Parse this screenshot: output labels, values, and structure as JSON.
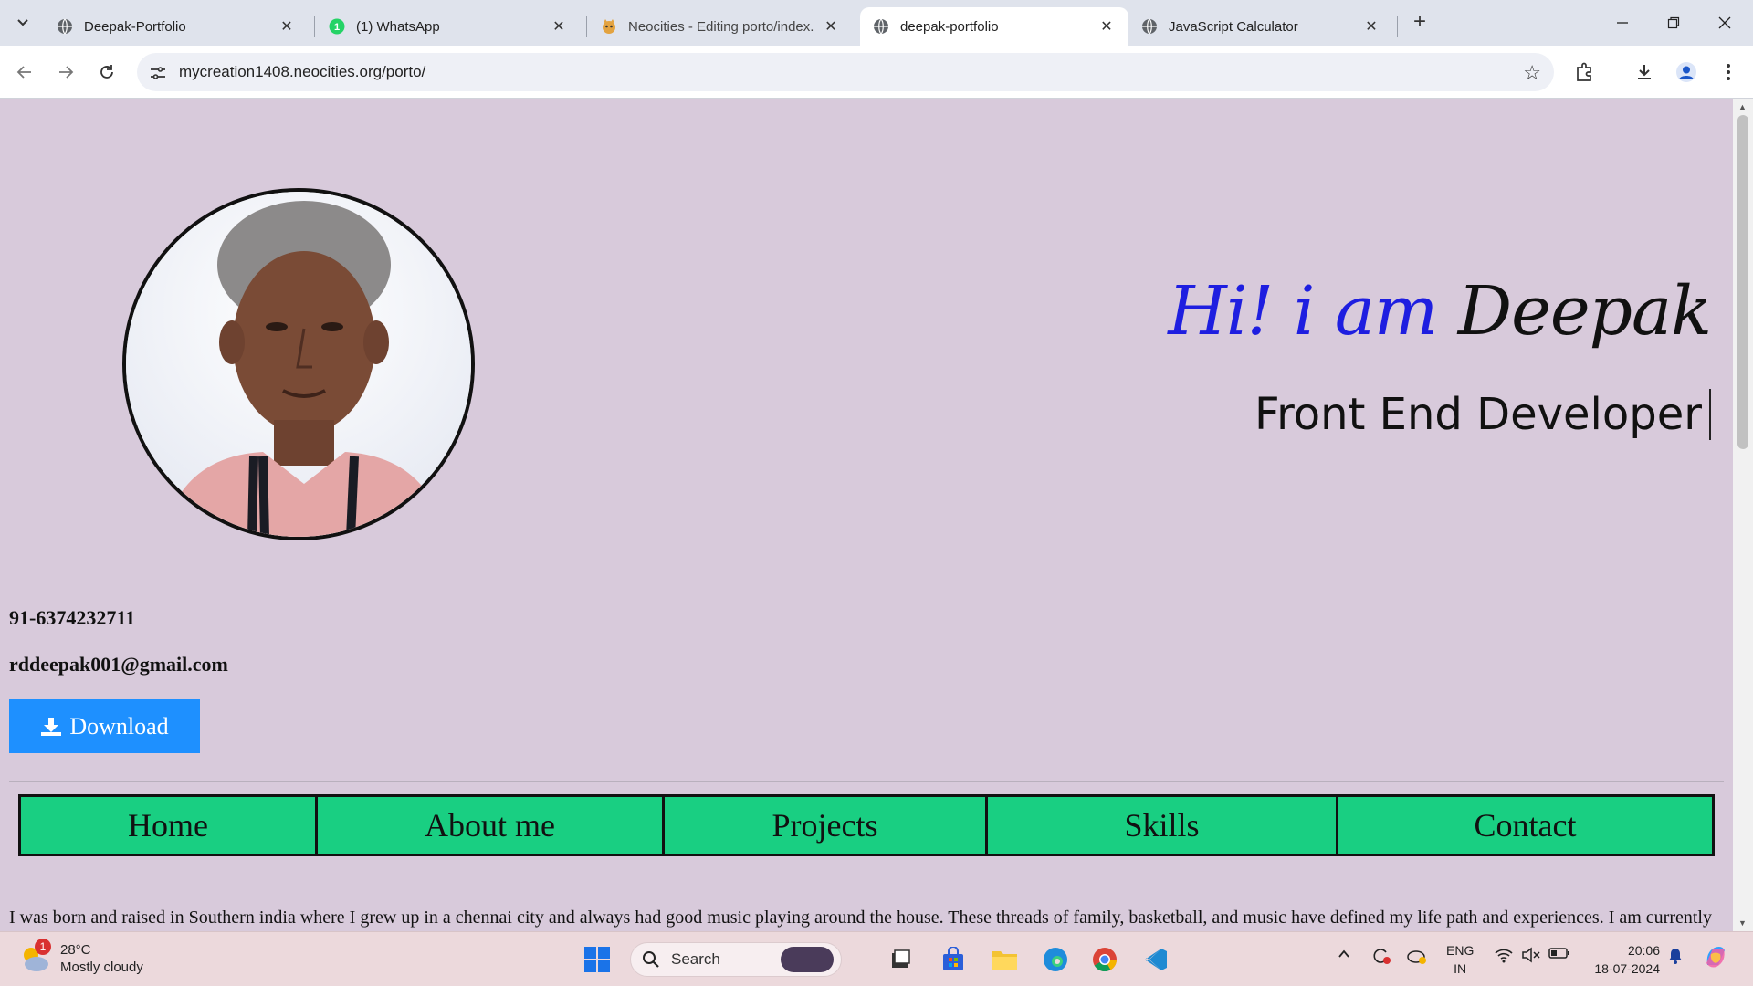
{
  "browser": {
    "tabs": [
      {
        "title": "Deepak-Portfolio",
        "icon": "globe-icon",
        "active": false
      },
      {
        "title": "(1) WhatsApp",
        "icon": "whatsapp-icon",
        "active": false
      },
      {
        "title": "Neocities - Editing porto/index.",
        "icon": "neocities-icon",
        "active": false
      },
      {
        "title": "deepak-portfolio",
        "icon": "globe-icon",
        "active": true
      },
      {
        "title": "JavaScript Calculator",
        "icon": "globe-icon",
        "active": false
      }
    ],
    "url": "mycreation1408.neocities.org/porto/"
  },
  "hero": {
    "greeting_part1": "Hi! i am",
    "greeting_name": "Deepak",
    "role": "Front End Developer"
  },
  "contact": {
    "phone": "91-6374232711",
    "email": "rddeepak001@gmail.com",
    "download_label": "Download"
  },
  "nav": {
    "items": [
      "Home",
      "About me",
      "Projects",
      "Skills",
      "Contact"
    ]
  },
  "about": {
    "bio": "I was born and raised in Southern india where I grew up in a chennai city and always had good music playing around the house. These threads of family, basketball, and music have defined my life path and experiences. I am currently"
  },
  "taskbar": {
    "weather_temp": "28°C",
    "weather_desc": "Mostly cloudy",
    "weather_badge": "1",
    "search_label": "Search",
    "lang_top": "ENG",
    "lang_bottom": "IN",
    "time": "20:06",
    "date": "18-07-2024"
  },
  "colors": {
    "page_bg": "#d8cadb",
    "nav_bg": "#19cf82",
    "download_bg": "#1e90ff",
    "greeting_blue": "#1e1ee0"
  }
}
